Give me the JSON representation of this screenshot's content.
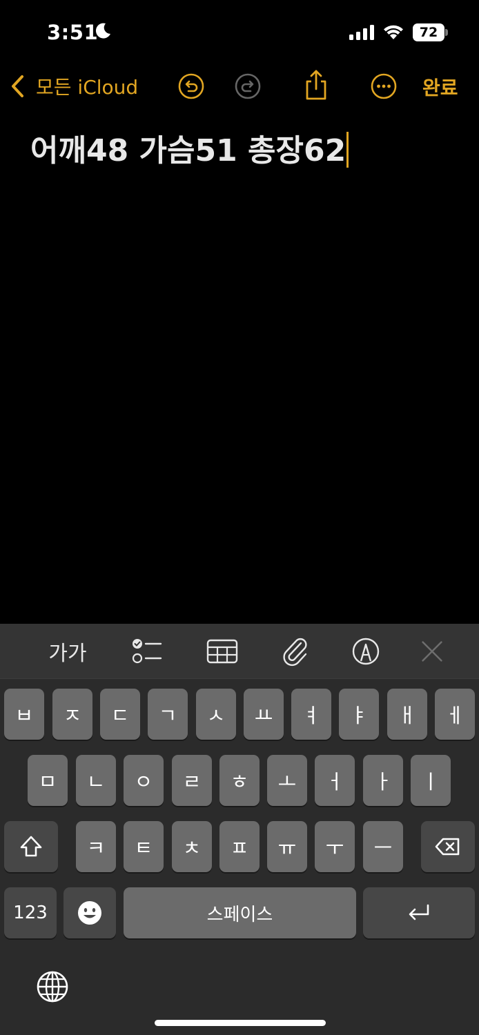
{
  "status_bar": {
    "time": "3:51",
    "battery": "72"
  },
  "nav": {
    "back_label": "모든 iCloud",
    "done_label": "완료"
  },
  "note": {
    "text": "어깨48 가슴51 총장62"
  },
  "keyboard": {
    "toolbar": {
      "format_label": "가가",
      "icons": [
        "checklist-icon",
        "table-icon",
        "attachment-icon",
        "markup-icon",
        "close-icon"
      ]
    },
    "rows": {
      "row1": [
        "ㅂ",
        "ㅈ",
        "ㄷ",
        "ㄱ",
        "ㅅ",
        "ㅛ",
        "ㅕ",
        "ㅑ",
        "ㅐ",
        "ㅔ"
      ],
      "row2": [
        "ㅁ",
        "ㄴ",
        "ㅇ",
        "ㄹ",
        "ㅎ",
        "ㅗ",
        "ㅓ",
        "ㅏ",
        "ㅣ"
      ],
      "row3": [
        "ㅋ",
        "ㅌ",
        "ㅊ",
        "ㅍ",
        "ㅠ",
        "ㅜ",
        "ㅡ"
      ]
    },
    "numbers_label": "123",
    "space_label": "스페이스"
  },
  "colors": {
    "accent": "#e2a622",
    "background": "#000000",
    "keyboard_bg": "#2b2b2b",
    "key_bg": "#6b6b6b",
    "key_dark_bg": "#474747"
  }
}
